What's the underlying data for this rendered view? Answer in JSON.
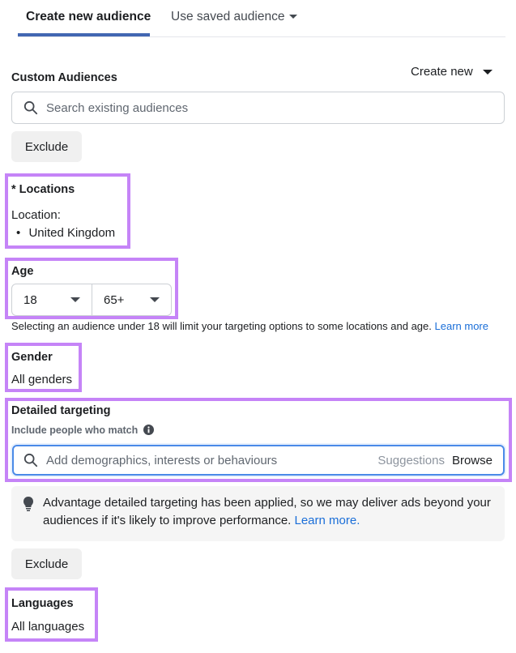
{
  "tabs": [
    {
      "label": "Create new audience",
      "active": true
    },
    {
      "label": "Use saved audience",
      "active": false
    }
  ],
  "custom_audiences": {
    "label": "Custom Audiences",
    "create_new_label": "Create new",
    "search_placeholder": "Search existing audiences",
    "exclude_label": "Exclude"
  },
  "locations": {
    "label": "* Locations",
    "sub_label": "Location:",
    "items": [
      "United Kingdom"
    ]
  },
  "age": {
    "label": "Age",
    "min": "18",
    "max": "65+",
    "note": "Selecting an audience under 18 will limit your targeting options to some locations and age.",
    "learn_more": "Learn more"
  },
  "gender": {
    "label": "Gender",
    "value": "All genders"
  },
  "detailed_targeting": {
    "label": "Detailed targeting",
    "sub_label": "Include people who match",
    "search_placeholder": "Add demographics, interests or behaviours",
    "suggestions_label": "Suggestions",
    "browse_label": "Browse",
    "advantage_message": "Advantage detailed targeting has been applied, so we may deliver ads beyond your audiences if it's likely to improve performance.",
    "advantage_learn_more": "Learn more.",
    "exclude_label": "Exclude"
  },
  "languages": {
    "label": "Languages",
    "value": "All languages"
  },
  "colors": {
    "accent": "#4267b2",
    "link": "#1a6ed8",
    "highlight": "#c584f7"
  }
}
